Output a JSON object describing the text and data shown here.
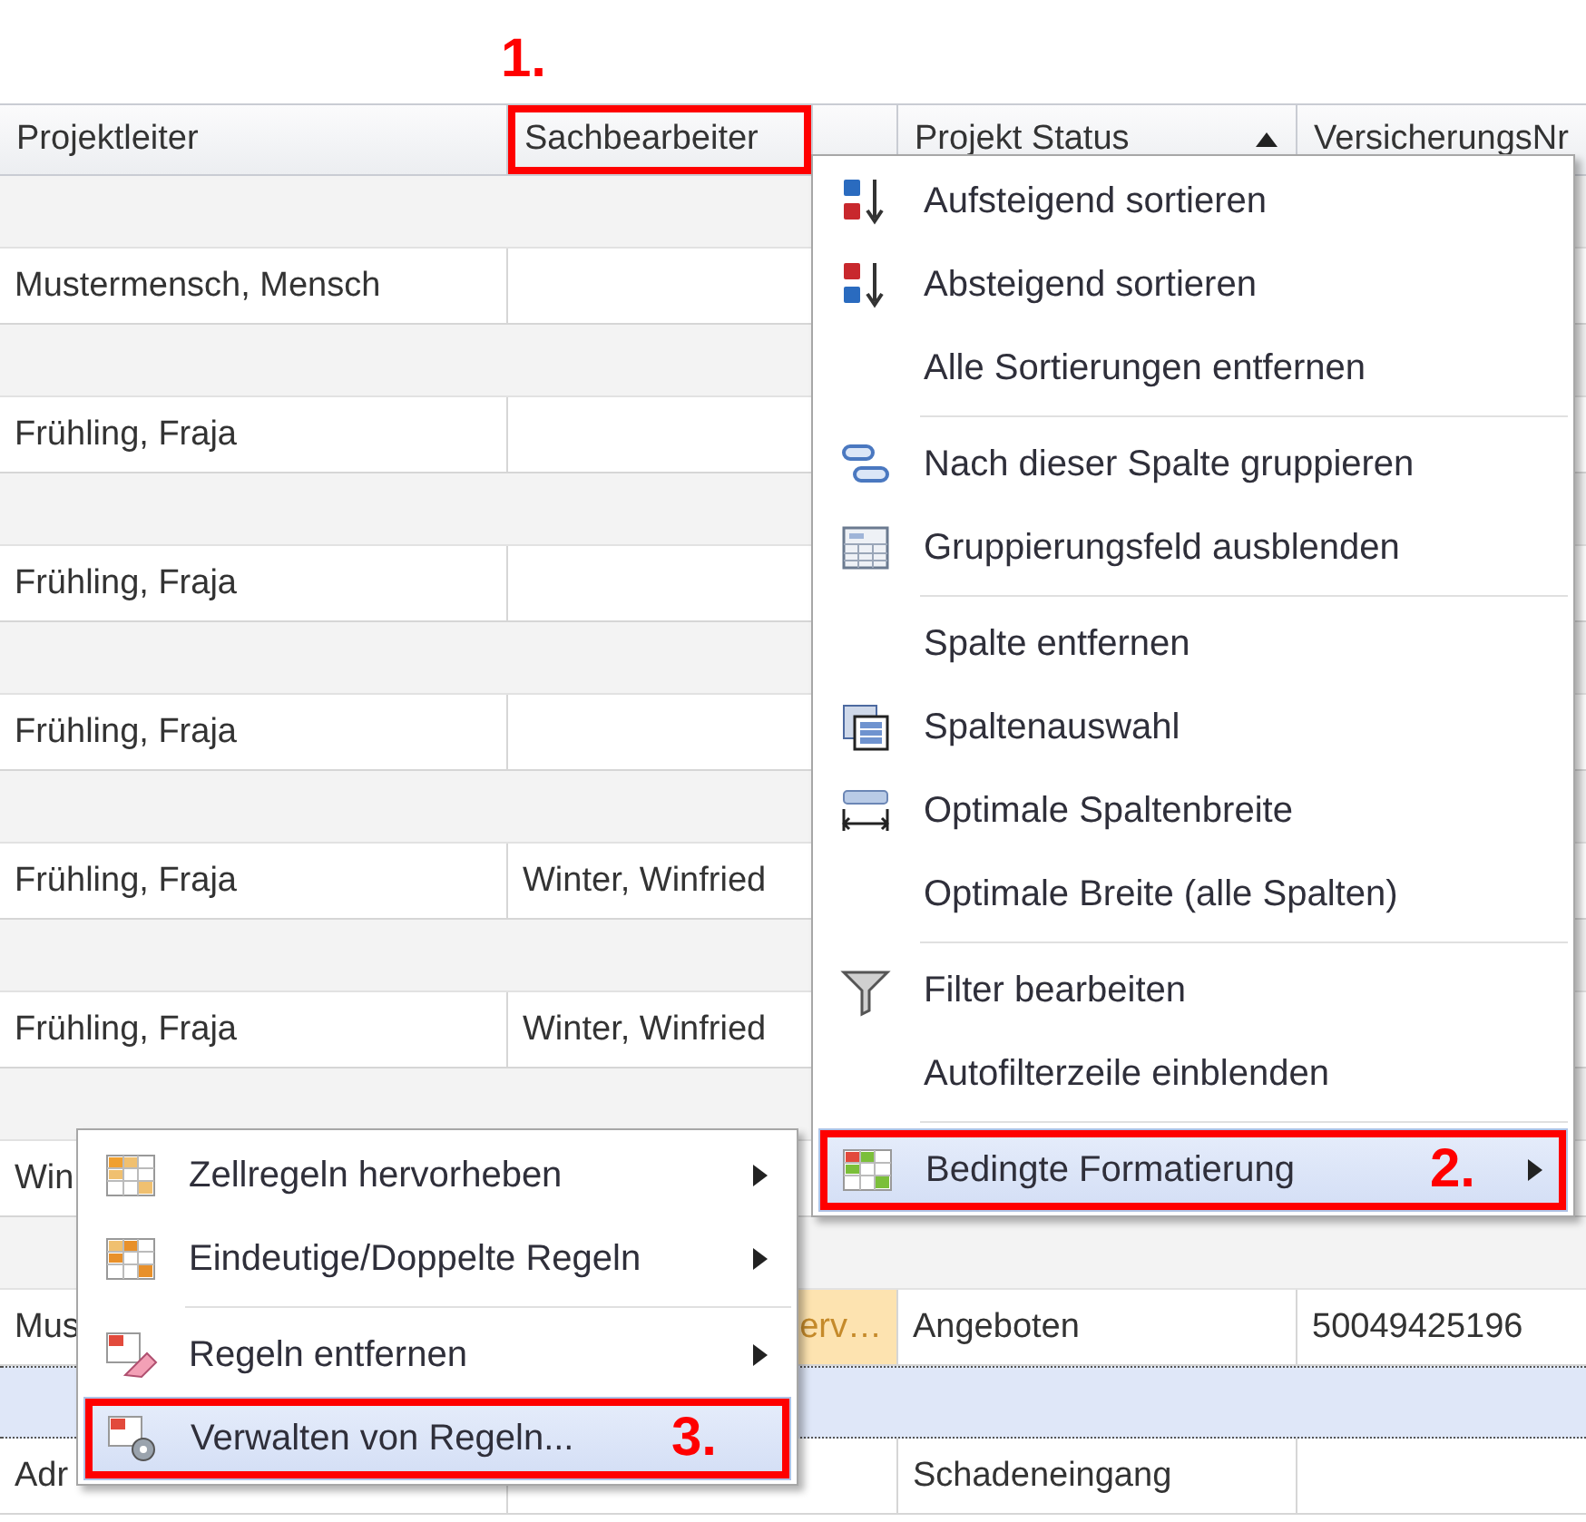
{
  "grid": {
    "columns": [
      {
        "label": "Projektleiter"
      },
      {
        "label": "Sachbearbeiter",
        "annotation": "1."
      },
      {
        "label": "Projekt Status",
        "sorted": true
      },
      {
        "label": "VersicherungsNr"
      }
    ],
    "rows": [
      {
        "kind": "group",
        "selected": false
      },
      {
        "kind": "data",
        "cells": [
          {
            "text": "Mustermensch, Mensch"
          },
          {
            "text": ""
          }
        ]
      },
      {
        "kind": "group",
        "selected": false
      },
      {
        "kind": "data",
        "cells": [
          {
            "text": "Frühling, Fraja"
          },
          {
            "text": ""
          }
        ]
      },
      {
        "kind": "group",
        "selected": false
      },
      {
        "kind": "data",
        "cells": [
          {
            "text": "Frühling, Fraja"
          },
          {
            "text": ""
          }
        ]
      },
      {
        "kind": "group",
        "selected": false
      },
      {
        "kind": "data",
        "cells": [
          {
            "text": "Frühling, Fraja"
          },
          {
            "text": ""
          }
        ]
      },
      {
        "kind": "group",
        "selected": false
      },
      {
        "kind": "data",
        "cells": [
          {
            "text": "Frühling, Fraja"
          },
          {
            "text": "Winter, Winfried"
          },
          {
            "text": ""
          },
          {
            "text": ""
          }
        ]
      },
      {
        "kind": "group",
        "selected": false
      },
      {
        "kind": "data",
        "cells": [
          {
            "text": "Frühling, Fraja"
          },
          {
            "text": "Winter, Winfried"
          },
          {
            "text": ""
          },
          {
            "text": ""
          }
        ]
      },
      {
        "kind": "group",
        "selected": false
      },
      {
        "kind": "data",
        "cells": [
          {
            "text": "Win"
          },
          {
            "text": ""
          },
          {
            "text": ""
          },
          {
            "text": ""
          }
        ]
      },
      {
        "kind": "group",
        "selected": false
      },
      {
        "kind": "data",
        "cells": [
          {
            "text": "Mus"
          },
          {
            "text": "erv…",
            "highlighted": true
          },
          {
            "text": "Angeboten"
          },
          {
            "text": "50049425196"
          }
        ]
      },
      {
        "kind": "group",
        "selected": true
      },
      {
        "kind": "data",
        "cells": [
          {
            "text": "Adr"
          },
          {
            "text": ""
          },
          {
            "text": "Schadeneingang"
          },
          {
            "text": ""
          }
        ]
      }
    ]
  },
  "context_menu": {
    "items": [
      {
        "label": "Aufsteigend sortieren",
        "submenu": false,
        "selected": false
      },
      {
        "label": "Absteigend sortieren",
        "submenu": false,
        "selected": false
      },
      {
        "label": "Alle Sortierungen entfernen",
        "submenu": false,
        "selected": false
      },
      {
        "label": "Nach dieser Spalte gruppieren",
        "separator_before": true,
        "submenu": false,
        "selected": false
      },
      {
        "label": "Gruppierungsfeld ausblenden",
        "submenu": false,
        "selected": false
      },
      {
        "label": "Spalte entfernen",
        "separator_before": true,
        "submenu": false,
        "selected": false
      },
      {
        "label": "Spaltenauswahl",
        "submenu": false,
        "selected": false
      },
      {
        "label": "Optimale Spaltenbreite",
        "submenu": false,
        "selected": false
      },
      {
        "label": "Optimale Breite (alle Spalten)",
        "submenu": false,
        "selected": false
      },
      {
        "label": "Filter bearbeiten",
        "separator_before": true,
        "submenu": false,
        "selected": false
      },
      {
        "label": "Autofilterzeile einblenden",
        "submenu": false,
        "selected": false
      },
      {
        "label": "Bedingte Formatierung",
        "separator_before": true,
        "submenu": true,
        "selected": true,
        "annotation": "2."
      }
    ]
  },
  "submenu": {
    "items": [
      {
        "label": "Zellregeln hervorheben",
        "submenu": true,
        "selected": false
      },
      {
        "label": "Eindeutige/Doppelte Regeln",
        "submenu": true,
        "selected": false
      },
      {
        "label": "Regeln entfernen",
        "separator_before": true,
        "submenu": true,
        "selected": false
      },
      {
        "label": "Verwalten von Regeln...",
        "submenu": false,
        "selected": true,
        "annotation": "3."
      }
    ]
  }
}
